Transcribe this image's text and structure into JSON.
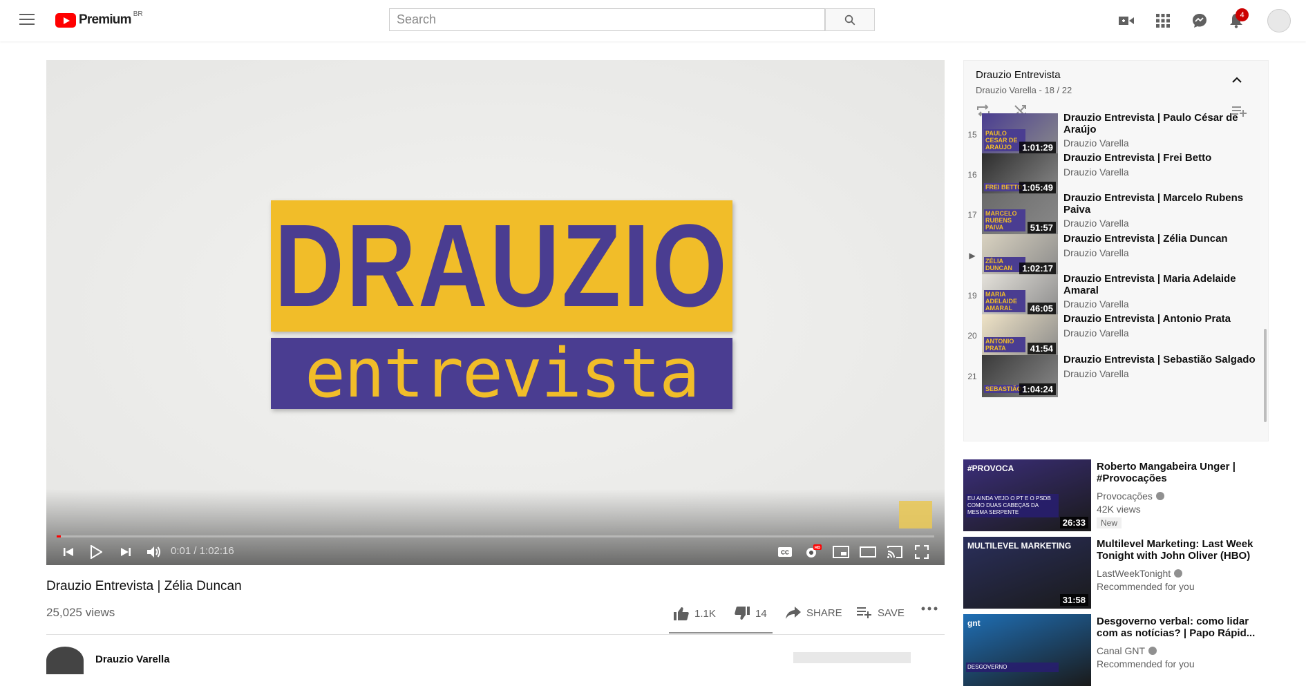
{
  "header": {
    "logo_text": "Premium",
    "country": "BR",
    "search_placeholder": "Search",
    "notifications_count": "4"
  },
  "video": {
    "logo_line1": "DRAUZIO",
    "logo_line2": "entrevista",
    "time": "0:01 / 1:02:16",
    "progress": 0.005,
    "title": "Drauzio Entrevista | Zélia Duncan",
    "views": "25,025 views",
    "likes": "1.1K",
    "dislikes": "14",
    "share_label": "SHARE",
    "save_label": "SAVE",
    "channel": "Drauzio Varella"
  },
  "playlist": {
    "title": "Drauzio Entrevista",
    "subtitle": "Drauzio Varella - 18 / 22",
    "items": [
      {
        "index": "15",
        "title": "Drauzio Entrevista | Paulo César de Araújo",
        "channel": "Drauzio Varella",
        "duration": "1:01:29",
        "thumb_label": "PAULO CESAR DE ARAÚJO",
        "thumb_color": "#4a3d91"
      },
      {
        "index": "16",
        "title": "Drauzio Entrevista | Frei Betto",
        "channel": "Drauzio Varella",
        "duration": "1:05:49",
        "thumb_label": "FREI BETTO",
        "thumb_color": "#2d2d2d"
      },
      {
        "index": "17",
        "title": "Drauzio Entrevista | Marcelo Rubens Paiva",
        "channel": "Drauzio Varella",
        "duration": "51:57",
        "thumb_label": "MARCELO RUBENS PAIVA",
        "thumb_color": "#6a6a6a"
      },
      {
        "index": "▶",
        "title": "Drauzio Entrevista | Zélia Duncan",
        "channel": "Drauzio Varella",
        "duration": "1:02:17",
        "thumb_label": "ZÉLIA DUNCAN",
        "thumb_color": "#d9d2c0"
      },
      {
        "index": "19",
        "title": "Drauzio Entrevista | Maria Adelaide Amaral",
        "channel": "Drauzio Varella",
        "duration": "46:05",
        "thumb_label": "MARIA ADELAIDE AMARAL",
        "thumb_color": "#e4e1da"
      },
      {
        "index": "20",
        "title": "Drauzio Entrevista | Antonio Prata",
        "channel": "Drauzio Varella",
        "duration": "41:54",
        "thumb_label": "ANTONIO PRATA",
        "thumb_color": "#efe3c6"
      },
      {
        "index": "21",
        "title": "Drauzio Entrevista | Sebastião Salgado",
        "channel": "Drauzio Varella",
        "duration": "1:04:24",
        "thumb_label": "SEBASTIÃO",
        "thumb_color": "#3a3a3a"
      }
    ]
  },
  "recommendations": [
    {
      "title": "Roberto Mangabeira Unger | #Provocações",
      "channel": "Provocações",
      "meta": "42K views",
      "badge": "New",
      "duration": "26:33",
      "thumb_text": "#PROVOCA",
      "thumb_caption": "EU AINDA VEJO O PT E O PSDB COMO DUAS CABEÇAS DA MESMA SERPENTE",
      "thumb_color": "#3b2e7a"
    },
    {
      "title": "Multilevel Marketing: Last Week Tonight with John Oliver (HBO)",
      "channel": "LastWeekTonight",
      "meta": "Recommended for you",
      "badge": "",
      "duration": "31:58",
      "thumb_text": "MULTILEVEL MARKETING",
      "thumb_caption": "",
      "thumb_color": "#2a2f5c"
    },
    {
      "title": "Desgoverno verbal: como lidar com as notícias? | Papo Rápid...",
      "channel": "Canal GNT",
      "meta": "Recommended for you",
      "badge": "",
      "duration": "",
      "thumb_text": "gnt",
      "thumb_caption": "DESGOVERNO",
      "thumb_color": "#1f6fb5"
    }
  ]
}
